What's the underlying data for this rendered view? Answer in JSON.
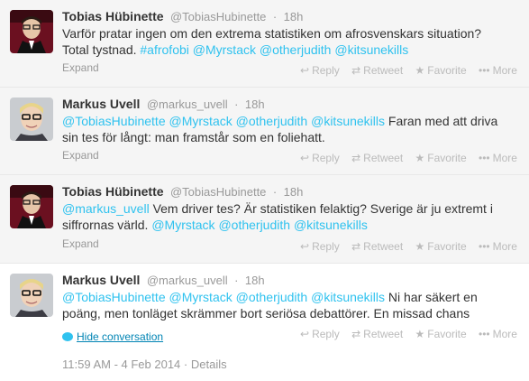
{
  "tweets": [
    {
      "fullname": "Tobias Hübinette",
      "handle": "@TobiasHubinette",
      "time": "18h",
      "text_line1": "Varför pratar ingen om den extrema statistiken om afrosvenskars situation?",
      "text_line2_plain": "Total tystnad.",
      "text_line2_links": [
        "#afrofobi",
        "@Myrstack",
        "@otherjudith",
        "@kitsunekills"
      ],
      "footer": "Expand"
    },
    {
      "fullname": "Markus Uvell",
      "handle": "@markus_uvell",
      "time": "18h",
      "text_links": [
        "@TobiasHubinette",
        "@Myrstack",
        "@otherjudith",
        "@kitsunekills"
      ],
      "text_rest1": "Faran med att driva",
      "text_line2": "sin tes för långt: man framstår som en foliehatt.",
      "footer": "Expand"
    },
    {
      "fullname": "Tobias Hübinette",
      "handle": "@TobiasHubinette",
      "time": "18h",
      "text_link_first": "@markus_uvell",
      "text_rest1": "Vem driver tes? Är statistiken felaktig? Sverige är ju extremt i",
      "text_line2_plain": "siffrornas värld.",
      "text_line2_links": [
        "@Myrstack",
        "@otherjudith",
        "@kitsunekills"
      ],
      "footer": "Expand"
    },
    {
      "fullname": "Markus Uvell",
      "handle": "@markus_uvell",
      "time": "18h",
      "text_links": [
        "@TobiasHubinette",
        "@Myrstack",
        "@otherjudith",
        "@kitsunekills"
      ],
      "text_rest1": "Ni har säkert en",
      "text_line2": "poäng, men tonläget skrämmer bort seriösa debattörer. En missad chans",
      "footer": "Hide conversation"
    }
  ],
  "actions": {
    "reply": "Reply",
    "retweet": "Retweet",
    "favorite": "Favorite",
    "more": "More"
  },
  "icons": {
    "reply": "reply-icon",
    "retweet": "retweet-icon",
    "favorite": "star-icon",
    "more": "more-icon",
    "conversation": "conversation-bubble-icon"
  },
  "meta": {
    "timestamp": "11:59 AM - 4 Feb 2014",
    "separator": "·",
    "details": "Details"
  },
  "colors": {
    "link": "#2fc2ef",
    "hide_link": "#0084b4",
    "gray_bg": "#f5f5f5",
    "muted": "#999999"
  }
}
